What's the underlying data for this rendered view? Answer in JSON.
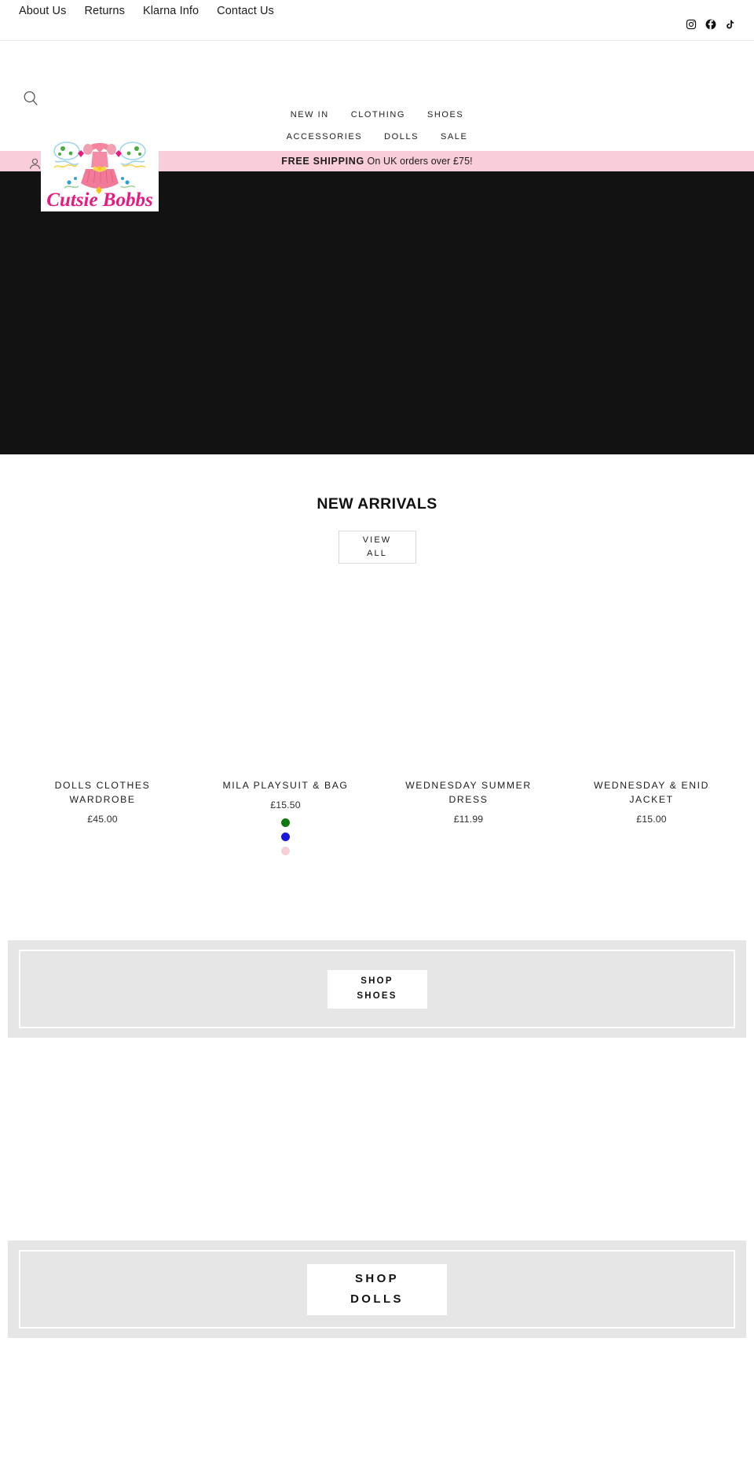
{
  "utility": {
    "links": [
      {
        "label": "About Us",
        "name": "about-us"
      },
      {
        "label": "Returns",
        "name": "returns"
      },
      {
        "label": "Klarna Info",
        "name": "klarna-info"
      },
      {
        "label": "Contact Us",
        "name": "contact-us"
      }
    ],
    "social": [
      {
        "label": "Instagram",
        "icon": "instagram-icon"
      },
      {
        "label": "Facebook",
        "icon": "facebook-icon"
      },
      {
        "label": "TikTok",
        "icon": "tiktok-icon"
      }
    ]
  },
  "header": {
    "search_icon": "search-icon",
    "account_icon": "account-icon",
    "logo_text": "Cutsie Bobbs",
    "nav_row_1": [
      {
        "label": "NEW IN"
      },
      {
        "label": "CLOTHING"
      },
      {
        "label": "SHOES"
      }
    ],
    "nav_row_2": [
      {
        "label": "ACCESSORIES"
      },
      {
        "label": "DOLLS"
      },
      {
        "label": "SALE"
      }
    ]
  },
  "shipping": {
    "strong": "FREE SHIPPING",
    "rest": " On UK orders over £75!",
    "background": "#f9cdd9"
  },
  "hero": {
    "background": "#121212"
  },
  "arrivals": {
    "title": "NEW ARRIVALS",
    "view_all_line1": "VIEW",
    "view_all_line2": "ALL",
    "products": [
      {
        "title": "DOLLS CLOTHES WARDROBE",
        "price": "£45.00",
        "swatches": []
      },
      {
        "title": "MILA PLAYSUIT & BAG",
        "price": "£15.50",
        "swatches": [
          "#137a13",
          "#1a1ad6",
          "#f7cfd8"
        ]
      },
      {
        "title": "WEDNESDAY SUMMER DRESS",
        "price": "£11.99",
        "swatches": []
      },
      {
        "title": "WEDNESDAY & ENID JACKET",
        "price": "£15.00",
        "swatches": []
      }
    ]
  },
  "promos": [
    {
      "name": "shop-shoes",
      "line1": "SHOP",
      "line2": "SHOES",
      "background": "#e6e6e6"
    },
    {
      "name": "shop-dolls",
      "line1": "SHOP",
      "line2": "DOLLS",
      "background": "#e6e6e6"
    }
  ]
}
